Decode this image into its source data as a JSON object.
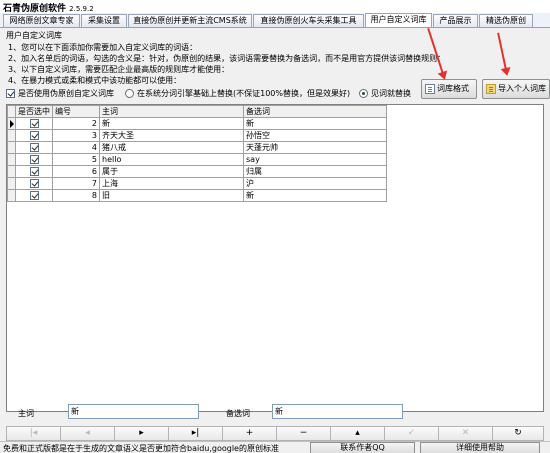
{
  "app": {
    "title": "石青伪原创软件",
    "version": "2.5.9.2"
  },
  "tabs": [
    {
      "label": "网络原创文章专家"
    },
    {
      "label": "采集设置"
    },
    {
      "label": "直接伪原创并更新主流CMS系统"
    },
    {
      "label": "直接伪原创火车头采集工具"
    },
    {
      "label": "用户自定义词库",
      "active": true
    },
    {
      "label": "产品展示"
    },
    {
      "label": "精选伪原创"
    }
  ],
  "panel": {
    "title": "用户自定义词库",
    "instructions": [
      "1、您可以在下面添加你需要加入自定义词库的词语：",
      "2、加入名单后的词语，勾选的含义是：针对，伪原创的结果，该词语需要替换为备选词，而不是用官方提供该词替换规则：",
      "3、以下自定义词库，需要匹配企业最高版的规则库才能使用：",
      "4、在暴力模式或柔和模式中该功能都可以使用："
    ],
    "buttons": {
      "format": "词库格式",
      "import": "导入个人词库"
    }
  },
  "options": {
    "use_custom": {
      "label": "是否使用伪原创自定义词库",
      "checked": true
    },
    "system_radio": {
      "label": "在系统分词引擎基础上替换(不保证100%替换，但是效果好)",
      "selected": false
    },
    "direct_radio": {
      "label": "见词就替换",
      "selected": true
    }
  },
  "grid": {
    "columns": [
      "是否选中",
      "编号",
      "主词",
      "备选词"
    ],
    "rows": [
      {
        "checked": true,
        "id": "2",
        "main": "新",
        "alt": "新"
      },
      {
        "checked": true,
        "id": "3",
        "main": "齐天大圣",
        "alt": "孙悟空"
      },
      {
        "checked": true,
        "id": "4",
        "main": "猪八戒",
        "alt": "天蓬元帅"
      },
      {
        "checked": true,
        "id": "5",
        "main": "hello",
        "alt": "say"
      },
      {
        "checked": true,
        "id": "6",
        "main": "属于",
        "alt": "归属"
      },
      {
        "checked": true,
        "id": "7",
        "main": "上海",
        "alt": "沪"
      },
      {
        "checked": true,
        "id": "8",
        "main": "旧",
        "alt": "新"
      }
    ]
  },
  "editor": {
    "main_label": "主词",
    "main_value": "新",
    "alt_label": "备选词",
    "alt_value": "新"
  },
  "navigator": [
    {
      "name": "nav-first-button",
      "glyph": "|◂",
      "enabled": false
    },
    {
      "name": "nav-prior-button",
      "glyph": "◂",
      "enabled": false
    },
    {
      "name": "nav-next-button",
      "glyph": "▸",
      "enabled": true
    },
    {
      "name": "nav-last-button",
      "glyph": "▸|",
      "enabled": true
    },
    {
      "name": "nav-insert-button",
      "glyph": "+",
      "enabled": true
    },
    {
      "name": "nav-delete-button",
      "glyph": "−",
      "enabled": true
    },
    {
      "name": "nav-edit-button",
      "glyph": "▴",
      "enabled": true
    },
    {
      "name": "nav-post-button",
      "glyph": "✓",
      "enabled": false
    },
    {
      "name": "nav-cancel-button",
      "glyph": "✕",
      "enabled": false
    },
    {
      "name": "nav-refresh-button",
      "glyph": "↻",
      "enabled": true
    }
  ],
  "status": {
    "text": "免费和正式版都是在于生成的文章语义是否更加符合baidu,google的原创标准",
    "contact": "联系作者QQ",
    "help": "详细使用帮助"
  },
  "colors": {
    "accent_arrow": "#e5312b"
  }
}
